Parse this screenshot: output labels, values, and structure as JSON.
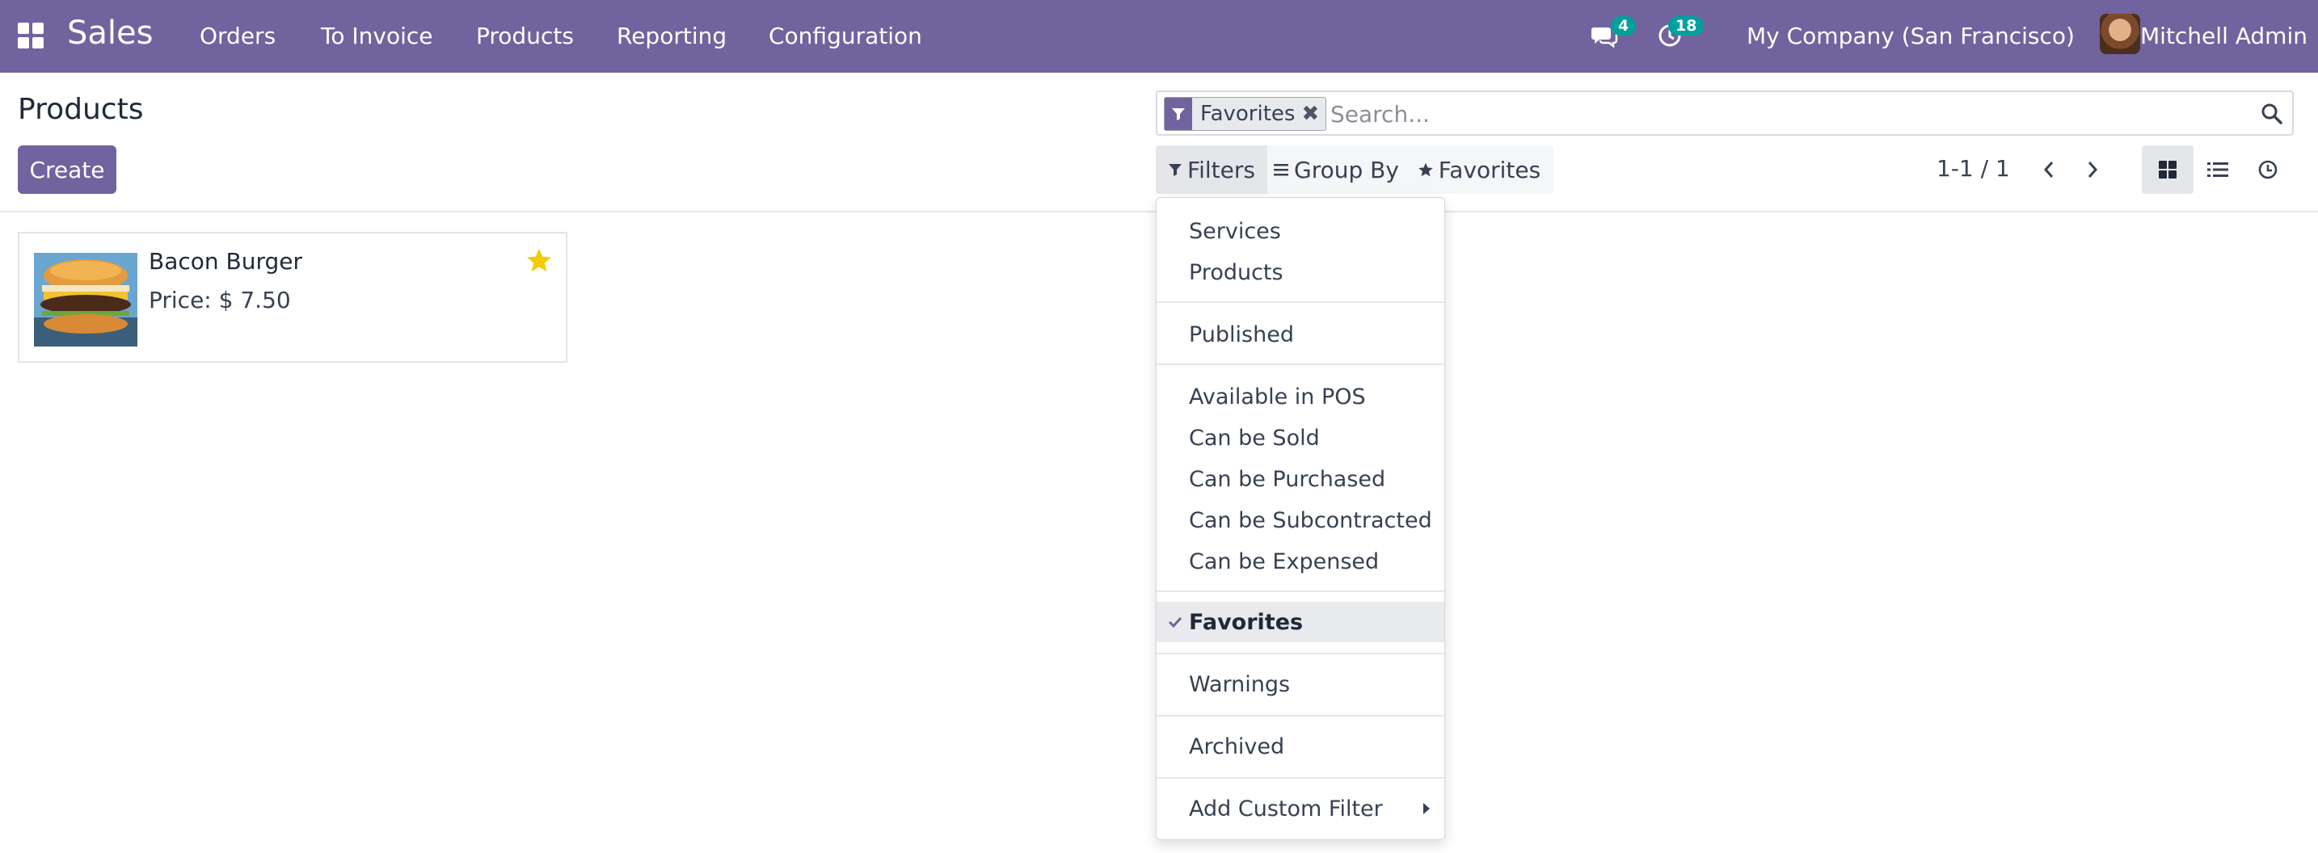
{
  "navbar": {
    "app_name": "Sales",
    "menu": [
      "Orders",
      "To Invoice",
      "Products",
      "Reporting",
      "Configuration"
    ],
    "messages_count": "4",
    "activities_count": "18",
    "company": "My Company (San Francisco)",
    "user": "Mitchell Admin",
    "color": "#71639e"
  },
  "control_panel": {
    "title": "Products",
    "create_label": "Create",
    "search": {
      "facet_label": "Favorites",
      "placeholder": "Search..."
    },
    "filters_label": "Filters",
    "group_by_label": "Group By",
    "favorites_label": "Favorites",
    "pager": "1-1 / 1",
    "active_view": "kanban"
  },
  "kanban": {
    "cards": [
      {
        "name": "Bacon Burger",
        "price": "Price: $ 7.50",
        "favorite": true
      }
    ]
  },
  "filters_dropdown": {
    "groups": [
      [
        "Services",
        "Products"
      ],
      [
        "Published"
      ],
      [
        "Available in POS",
        "Can be Sold",
        "Can be Purchased",
        "Can be Subcontracted",
        "Can be Expensed"
      ],
      [
        "Favorites"
      ],
      [
        "Warnings"
      ],
      [
        "Archived"
      ]
    ],
    "selected": "Favorites",
    "custom_filter_label": "Add Custom Filter"
  }
}
